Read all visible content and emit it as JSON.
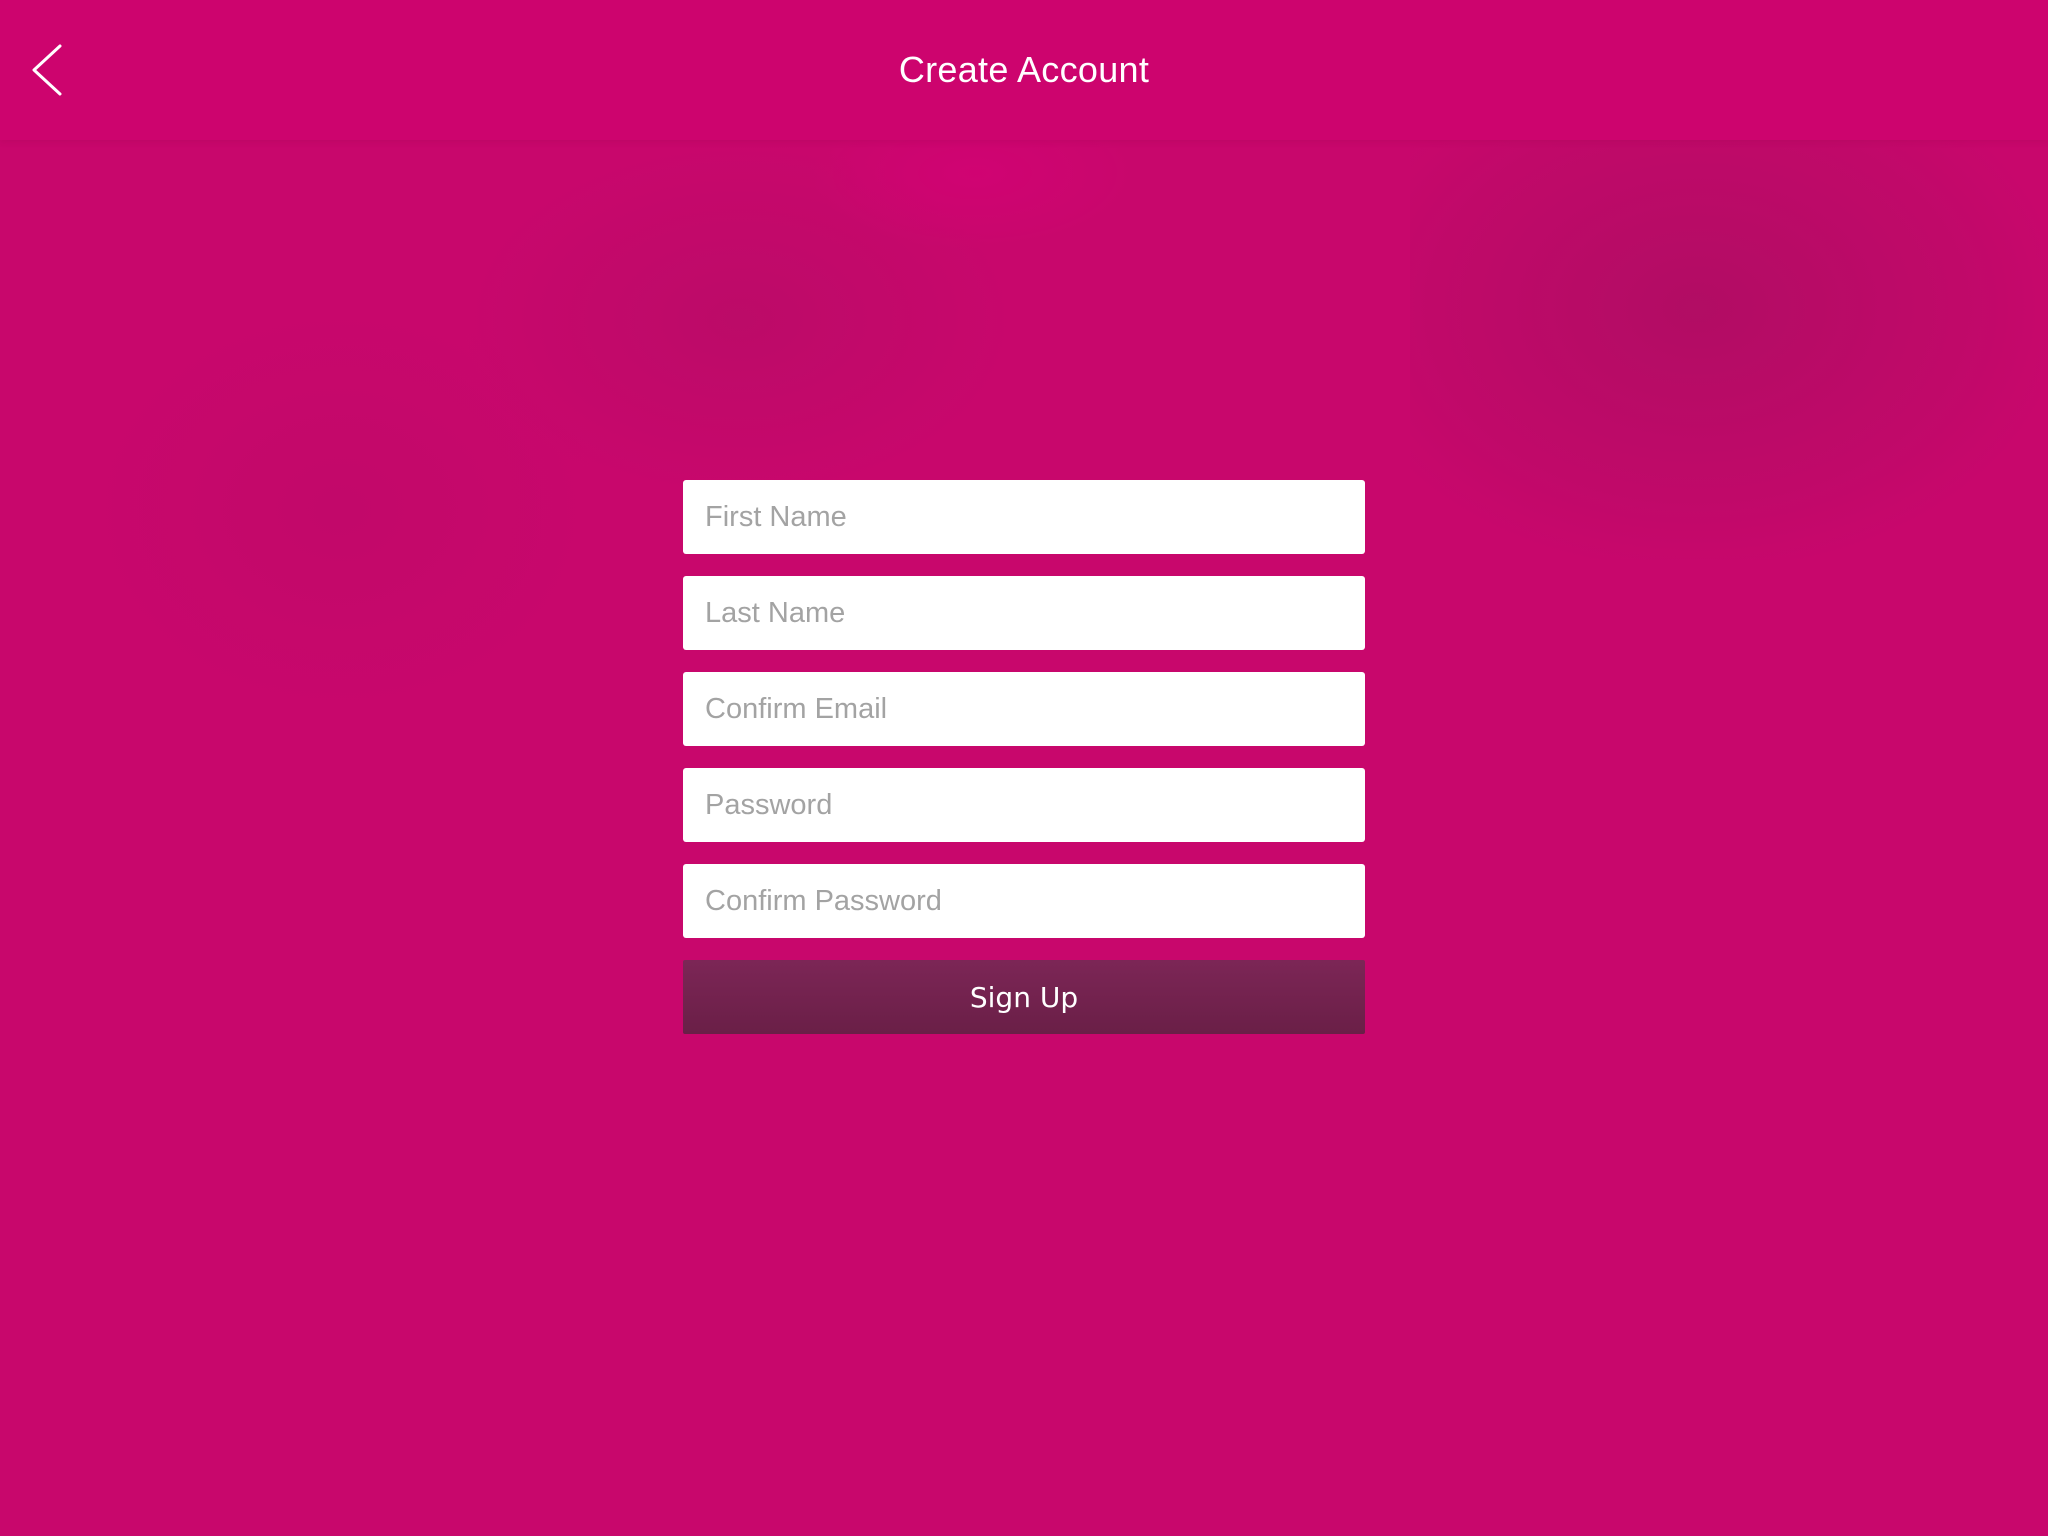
{
  "header": {
    "title": "Create Account",
    "back_icon": "chevron-left-icon"
  },
  "form": {
    "fields": [
      {
        "placeholder": "First Name",
        "value": ""
      },
      {
        "placeholder": "Last Name",
        "value": ""
      },
      {
        "placeholder": "Confirm Email",
        "value": ""
      },
      {
        "placeholder": "Password",
        "value": ""
      },
      {
        "placeholder": "Confirm Password",
        "value": ""
      }
    ],
    "submit_label": "Sign Up"
  },
  "colors": {
    "background": "#c8076c",
    "header": "#cd046e",
    "button": "#74224f",
    "field": "#ffffff",
    "placeholder": "#a3a3a3",
    "header_text": "#ffffff"
  }
}
